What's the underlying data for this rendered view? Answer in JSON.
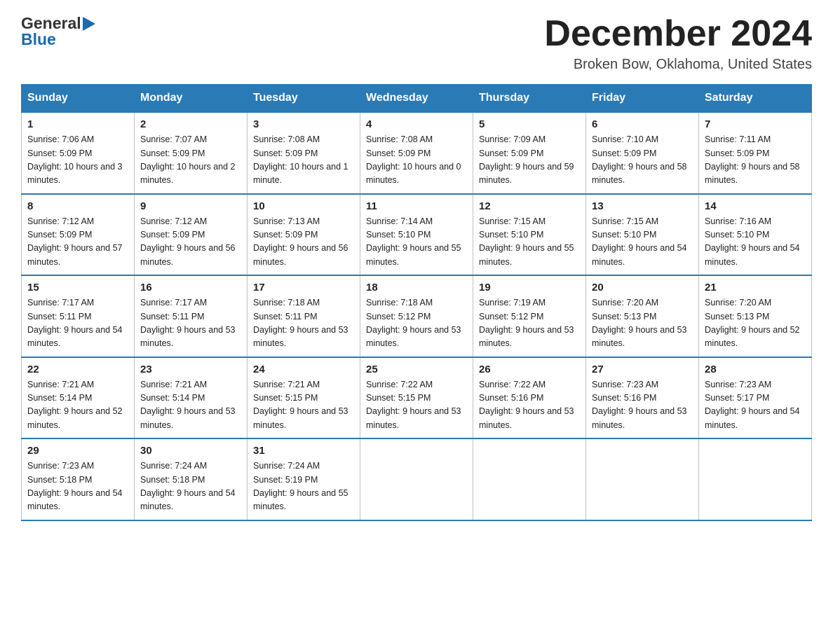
{
  "header": {
    "logo_general": "General",
    "logo_blue": "Blue",
    "title": "December 2024",
    "subtitle": "Broken Bow, Oklahoma, United States"
  },
  "days_of_week": [
    "Sunday",
    "Monday",
    "Tuesday",
    "Wednesday",
    "Thursday",
    "Friday",
    "Saturday"
  ],
  "weeks": [
    [
      {
        "day": "1",
        "sunrise": "7:06 AM",
        "sunset": "5:09 PM",
        "daylight": "10 hours and 3 minutes."
      },
      {
        "day": "2",
        "sunrise": "7:07 AM",
        "sunset": "5:09 PM",
        "daylight": "10 hours and 2 minutes."
      },
      {
        "day": "3",
        "sunrise": "7:08 AM",
        "sunset": "5:09 PM",
        "daylight": "10 hours and 1 minute."
      },
      {
        "day": "4",
        "sunrise": "7:08 AM",
        "sunset": "5:09 PM",
        "daylight": "10 hours and 0 minutes."
      },
      {
        "day": "5",
        "sunrise": "7:09 AM",
        "sunset": "5:09 PM",
        "daylight": "9 hours and 59 minutes."
      },
      {
        "day": "6",
        "sunrise": "7:10 AM",
        "sunset": "5:09 PM",
        "daylight": "9 hours and 58 minutes."
      },
      {
        "day": "7",
        "sunrise": "7:11 AM",
        "sunset": "5:09 PM",
        "daylight": "9 hours and 58 minutes."
      }
    ],
    [
      {
        "day": "8",
        "sunrise": "7:12 AM",
        "sunset": "5:09 PM",
        "daylight": "9 hours and 57 minutes."
      },
      {
        "day": "9",
        "sunrise": "7:12 AM",
        "sunset": "5:09 PM",
        "daylight": "9 hours and 56 minutes."
      },
      {
        "day": "10",
        "sunrise": "7:13 AM",
        "sunset": "5:09 PM",
        "daylight": "9 hours and 56 minutes."
      },
      {
        "day": "11",
        "sunrise": "7:14 AM",
        "sunset": "5:10 PM",
        "daylight": "9 hours and 55 minutes."
      },
      {
        "day": "12",
        "sunrise": "7:15 AM",
        "sunset": "5:10 PM",
        "daylight": "9 hours and 55 minutes."
      },
      {
        "day": "13",
        "sunrise": "7:15 AM",
        "sunset": "5:10 PM",
        "daylight": "9 hours and 54 minutes."
      },
      {
        "day": "14",
        "sunrise": "7:16 AM",
        "sunset": "5:10 PM",
        "daylight": "9 hours and 54 minutes."
      }
    ],
    [
      {
        "day": "15",
        "sunrise": "7:17 AM",
        "sunset": "5:11 PM",
        "daylight": "9 hours and 54 minutes."
      },
      {
        "day": "16",
        "sunrise": "7:17 AM",
        "sunset": "5:11 PM",
        "daylight": "9 hours and 53 minutes."
      },
      {
        "day": "17",
        "sunrise": "7:18 AM",
        "sunset": "5:11 PM",
        "daylight": "9 hours and 53 minutes."
      },
      {
        "day": "18",
        "sunrise": "7:18 AM",
        "sunset": "5:12 PM",
        "daylight": "9 hours and 53 minutes."
      },
      {
        "day": "19",
        "sunrise": "7:19 AM",
        "sunset": "5:12 PM",
        "daylight": "9 hours and 53 minutes."
      },
      {
        "day": "20",
        "sunrise": "7:20 AM",
        "sunset": "5:13 PM",
        "daylight": "9 hours and 53 minutes."
      },
      {
        "day": "21",
        "sunrise": "7:20 AM",
        "sunset": "5:13 PM",
        "daylight": "9 hours and 52 minutes."
      }
    ],
    [
      {
        "day": "22",
        "sunrise": "7:21 AM",
        "sunset": "5:14 PM",
        "daylight": "9 hours and 52 minutes."
      },
      {
        "day": "23",
        "sunrise": "7:21 AM",
        "sunset": "5:14 PM",
        "daylight": "9 hours and 53 minutes."
      },
      {
        "day": "24",
        "sunrise": "7:21 AM",
        "sunset": "5:15 PM",
        "daylight": "9 hours and 53 minutes."
      },
      {
        "day": "25",
        "sunrise": "7:22 AM",
        "sunset": "5:15 PM",
        "daylight": "9 hours and 53 minutes."
      },
      {
        "day": "26",
        "sunrise": "7:22 AM",
        "sunset": "5:16 PM",
        "daylight": "9 hours and 53 minutes."
      },
      {
        "day": "27",
        "sunrise": "7:23 AM",
        "sunset": "5:16 PM",
        "daylight": "9 hours and 53 minutes."
      },
      {
        "day": "28",
        "sunrise": "7:23 AM",
        "sunset": "5:17 PM",
        "daylight": "9 hours and 54 minutes."
      }
    ],
    [
      {
        "day": "29",
        "sunrise": "7:23 AM",
        "sunset": "5:18 PM",
        "daylight": "9 hours and 54 minutes."
      },
      {
        "day": "30",
        "sunrise": "7:24 AM",
        "sunset": "5:18 PM",
        "daylight": "9 hours and 54 minutes."
      },
      {
        "day": "31",
        "sunrise": "7:24 AM",
        "sunset": "5:19 PM",
        "daylight": "9 hours and 55 minutes."
      },
      {
        "day": "",
        "sunrise": "",
        "sunset": "",
        "daylight": ""
      },
      {
        "day": "",
        "sunrise": "",
        "sunset": "",
        "daylight": ""
      },
      {
        "day": "",
        "sunrise": "",
        "sunset": "",
        "daylight": ""
      },
      {
        "day": "",
        "sunrise": "",
        "sunset": "",
        "daylight": ""
      }
    ]
  ],
  "labels": {
    "sunrise_prefix": "Sunrise: ",
    "sunset_prefix": "Sunset: ",
    "daylight_prefix": "Daylight: "
  }
}
